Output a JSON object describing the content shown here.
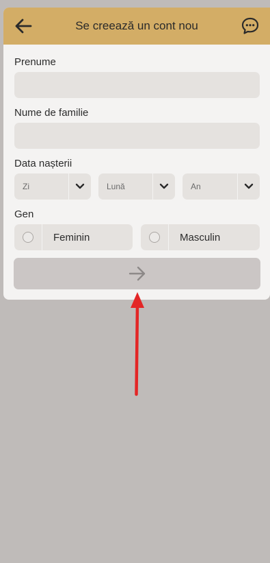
{
  "header": {
    "title": "Se creează un cont nou",
    "back_icon": "arrow-left-icon",
    "chat_icon": "chat-bubble-icon",
    "background_color": "#d3ad66"
  },
  "form": {
    "first_name": {
      "label": "Prenume",
      "value": ""
    },
    "last_name": {
      "label": "Nume de familie",
      "value": ""
    },
    "birth_date": {
      "label": "Data nașterii",
      "day_placeholder": "Zi",
      "month_placeholder": "Lună",
      "year_placeholder": "An"
    },
    "gender": {
      "label": "Gen",
      "options": [
        "Feminin",
        "Masculin"
      ]
    },
    "next_button_icon": "arrow-right-icon"
  },
  "annotation": {
    "color": "#e32626",
    "type": "red-arrow"
  }
}
